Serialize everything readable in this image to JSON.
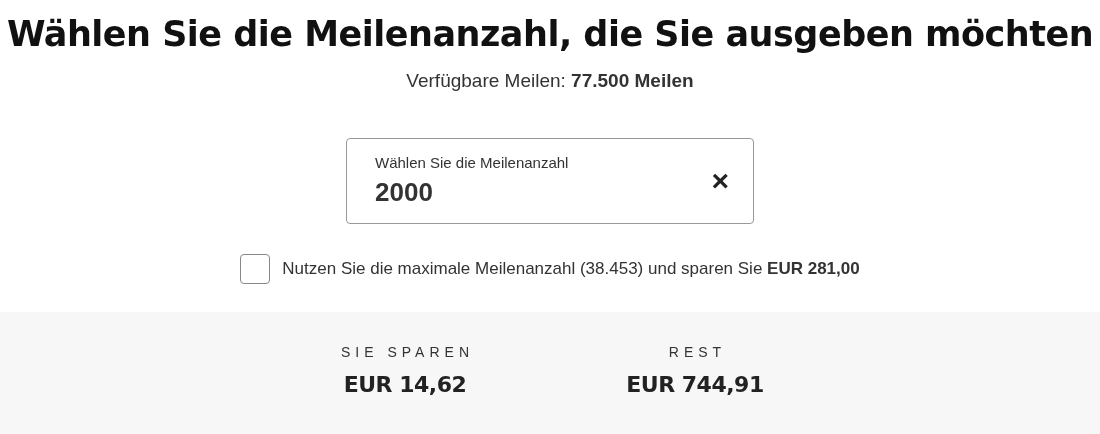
{
  "title": "Wählen Sie die Meilenanzahl, die Sie ausgeben möchten",
  "available": "Verfügbare Meilen: **77.500 Meilen**",
  "miles_field": {
    "label": "Wählen Sie die Meilenanzahl",
    "value": "2000",
    "clear": "×"
  },
  "max_option": {
    "checked": false,
    "label": "Nutzen Sie die maximale Meilenanzahl (38.453) und sparen Sie **EUR 281,00**"
  },
  "summary": [
    {
      "label": "SIE SPAREN",
      "value": "EUR 14,62"
    },
    {
      "label": "REST",
      "value": "EUR 744,91"
    }
  ]
}
